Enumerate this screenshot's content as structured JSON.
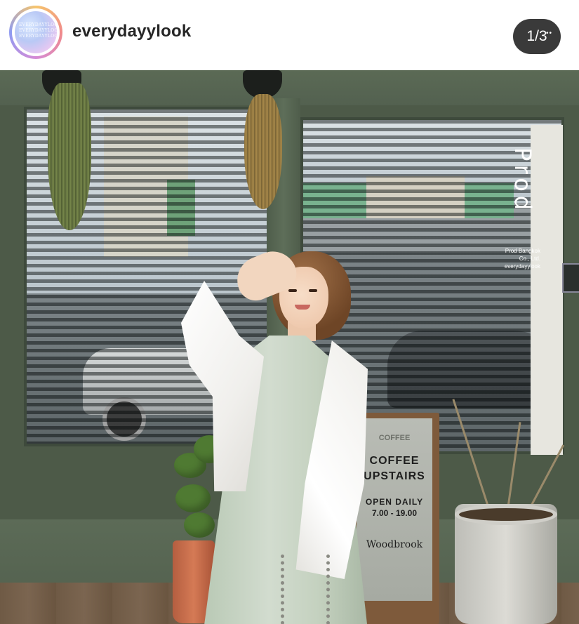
{
  "header": {
    "username": "everydayylook",
    "avatar_text": "EVERYDAYYLOOK\nEVERYDAYYLOOK\nEVERYDAYYLOOK",
    "carousel_counter": "1/3",
    "counter_dots": "••"
  },
  "photo": {
    "storefront_sign": "Prod",
    "storefront_sign_small": "Prod Bangkok\nCo., Ltd.\neverydayylook",
    "signboard": {
      "faded_text": "COFFEE",
      "line1": "COFFEE",
      "line2": "UPSTAIRS",
      "line3": "OPEN DAILY",
      "hours": "7.00 - 19.00",
      "brand": "Woodbrook"
    }
  },
  "colors": {
    "wall_green": "#536150",
    "counter_bg": "#3a3a3a",
    "username_text": "#262626"
  },
  "icons": {
    "avatar": "profile-avatar",
    "counter": "carousel-position-indicator"
  }
}
